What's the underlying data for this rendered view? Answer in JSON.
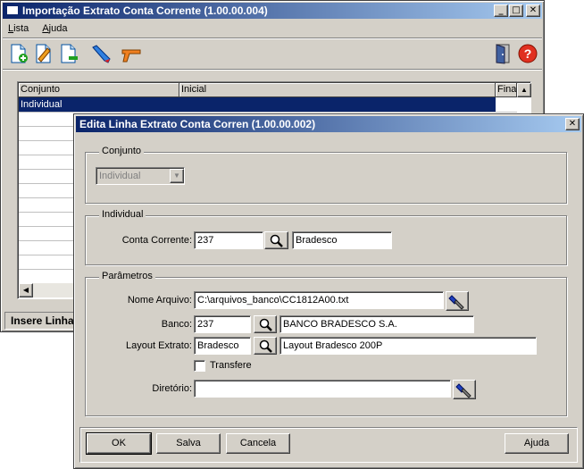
{
  "main_window": {
    "title": "Importação Extrato Conta Corrente (1.00.00.004)",
    "menu": [
      {
        "label": "Lista",
        "mnemonic": "L",
        "rest": "ista"
      },
      {
        "label": "Ajuda",
        "mnemonic": "A",
        "rest": "juda"
      }
    ],
    "toolbar": {
      "icons": [
        "add-document-icon",
        "edit-document-icon",
        "remove-document-icon",
        "pencil-icon",
        "gun-icon",
        "exit-door-icon",
        "help-icon"
      ],
      "help_glyph": "?"
    },
    "grid": {
      "columns": [
        "Conjunto",
        "Inicial",
        "Final"
      ],
      "rows": [
        [
          "Individual",
          "",
          ""
        ]
      ]
    },
    "status_text": "Insere Linha"
  },
  "dialog": {
    "title": "Edita Linha Extrato Conta Corren (1.00.00.002)",
    "close_glyph": "✕",
    "conjunto": {
      "legend": "Conjunto",
      "select_value": "Individual"
    },
    "individual": {
      "legend": "Individual",
      "conta_label": "Conta Corrente:",
      "conta_code": "237",
      "conta_name": "Bradesco"
    },
    "parametros": {
      "legend": "Parâmetros",
      "nome_arquivo_label": "Nome Arquivo:",
      "nome_arquivo_value": "C:\\arquivos_banco\\CC1812A00.txt",
      "banco_label": "Banco:",
      "banco_code": "237",
      "banco_name": "BANCO BRADESCO S.A.",
      "layout_label": "Layout Extrato:",
      "layout_code": "Bradesco",
      "layout_name": "Layout Bradesco 200P",
      "transfere_label": "Transfere",
      "diretorio_label": "Diretório:",
      "diretorio_value": ""
    },
    "buttons": {
      "ok": "OK",
      "salva": "Salva",
      "cancela": "Cancela",
      "ajuda": "Ajuda"
    }
  }
}
